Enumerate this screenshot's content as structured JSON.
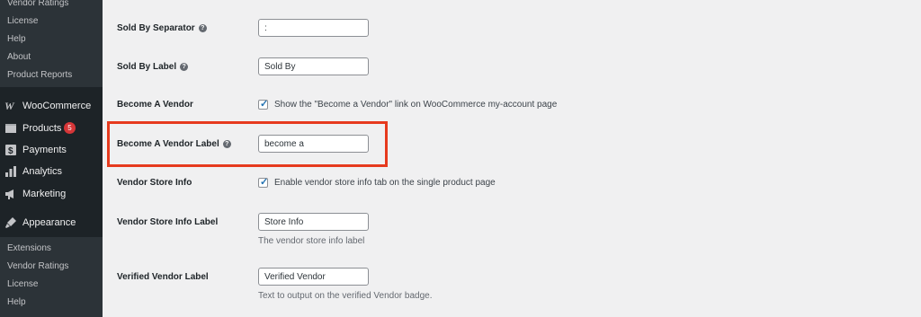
{
  "sidebar": {
    "top_submenu": [
      "Vendor Ratings",
      "License",
      "Help",
      "About",
      "Product Reports"
    ],
    "menu": [
      {
        "label": "WooCommerce",
        "icon": "woocommerce-icon"
      },
      {
        "label": "Products",
        "icon": "products-icon",
        "badge": "5"
      },
      {
        "label": "Payments",
        "icon": "payments-icon"
      },
      {
        "label": "Analytics",
        "icon": "analytics-icon"
      },
      {
        "label": "Marketing",
        "icon": "marketing-icon"
      },
      {
        "label": "Appearance",
        "icon": "appearance-icon"
      }
    ],
    "bottom_submenu": [
      "Extensions",
      "Vendor Ratings",
      "License",
      "Help"
    ]
  },
  "settings": {
    "sold_by_separator": {
      "label": "Sold By Separator",
      "value": ":"
    },
    "sold_by_label": {
      "label": "Sold By Label",
      "value": "Sold By"
    },
    "become_vendor": {
      "label": "Become A Vendor",
      "checked": true,
      "text": "Show the \"Become a Vendor\" link on WooCommerce my-account page"
    },
    "become_vendor_label": {
      "label": "Become A Vendor Label",
      "value": "become a"
    },
    "vendor_store_info": {
      "label": "Vendor Store Info",
      "checked": true,
      "text": "Enable vendor store info tab on the single product page"
    },
    "vendor_store_info_label": {
      "label": "Vendor Store Info Label",
      "value": "Store Info",
      "description": "The vendor store info label"
    },
    "verified_vendor_label": {
      "label": "Verified Vendor Label",
      "value": "Verified Vendor",
      "description": "Text to output on the verified Vendor badge."
    }
  },
  "colors": {
    "sidebar_bg": "#1d2327",
    "submenu_bg": "#2c3338",
    "badge": "#d63638",
    "highlight": "#e63a1e",
    "checkbox": "#2271b1"
  }
}
